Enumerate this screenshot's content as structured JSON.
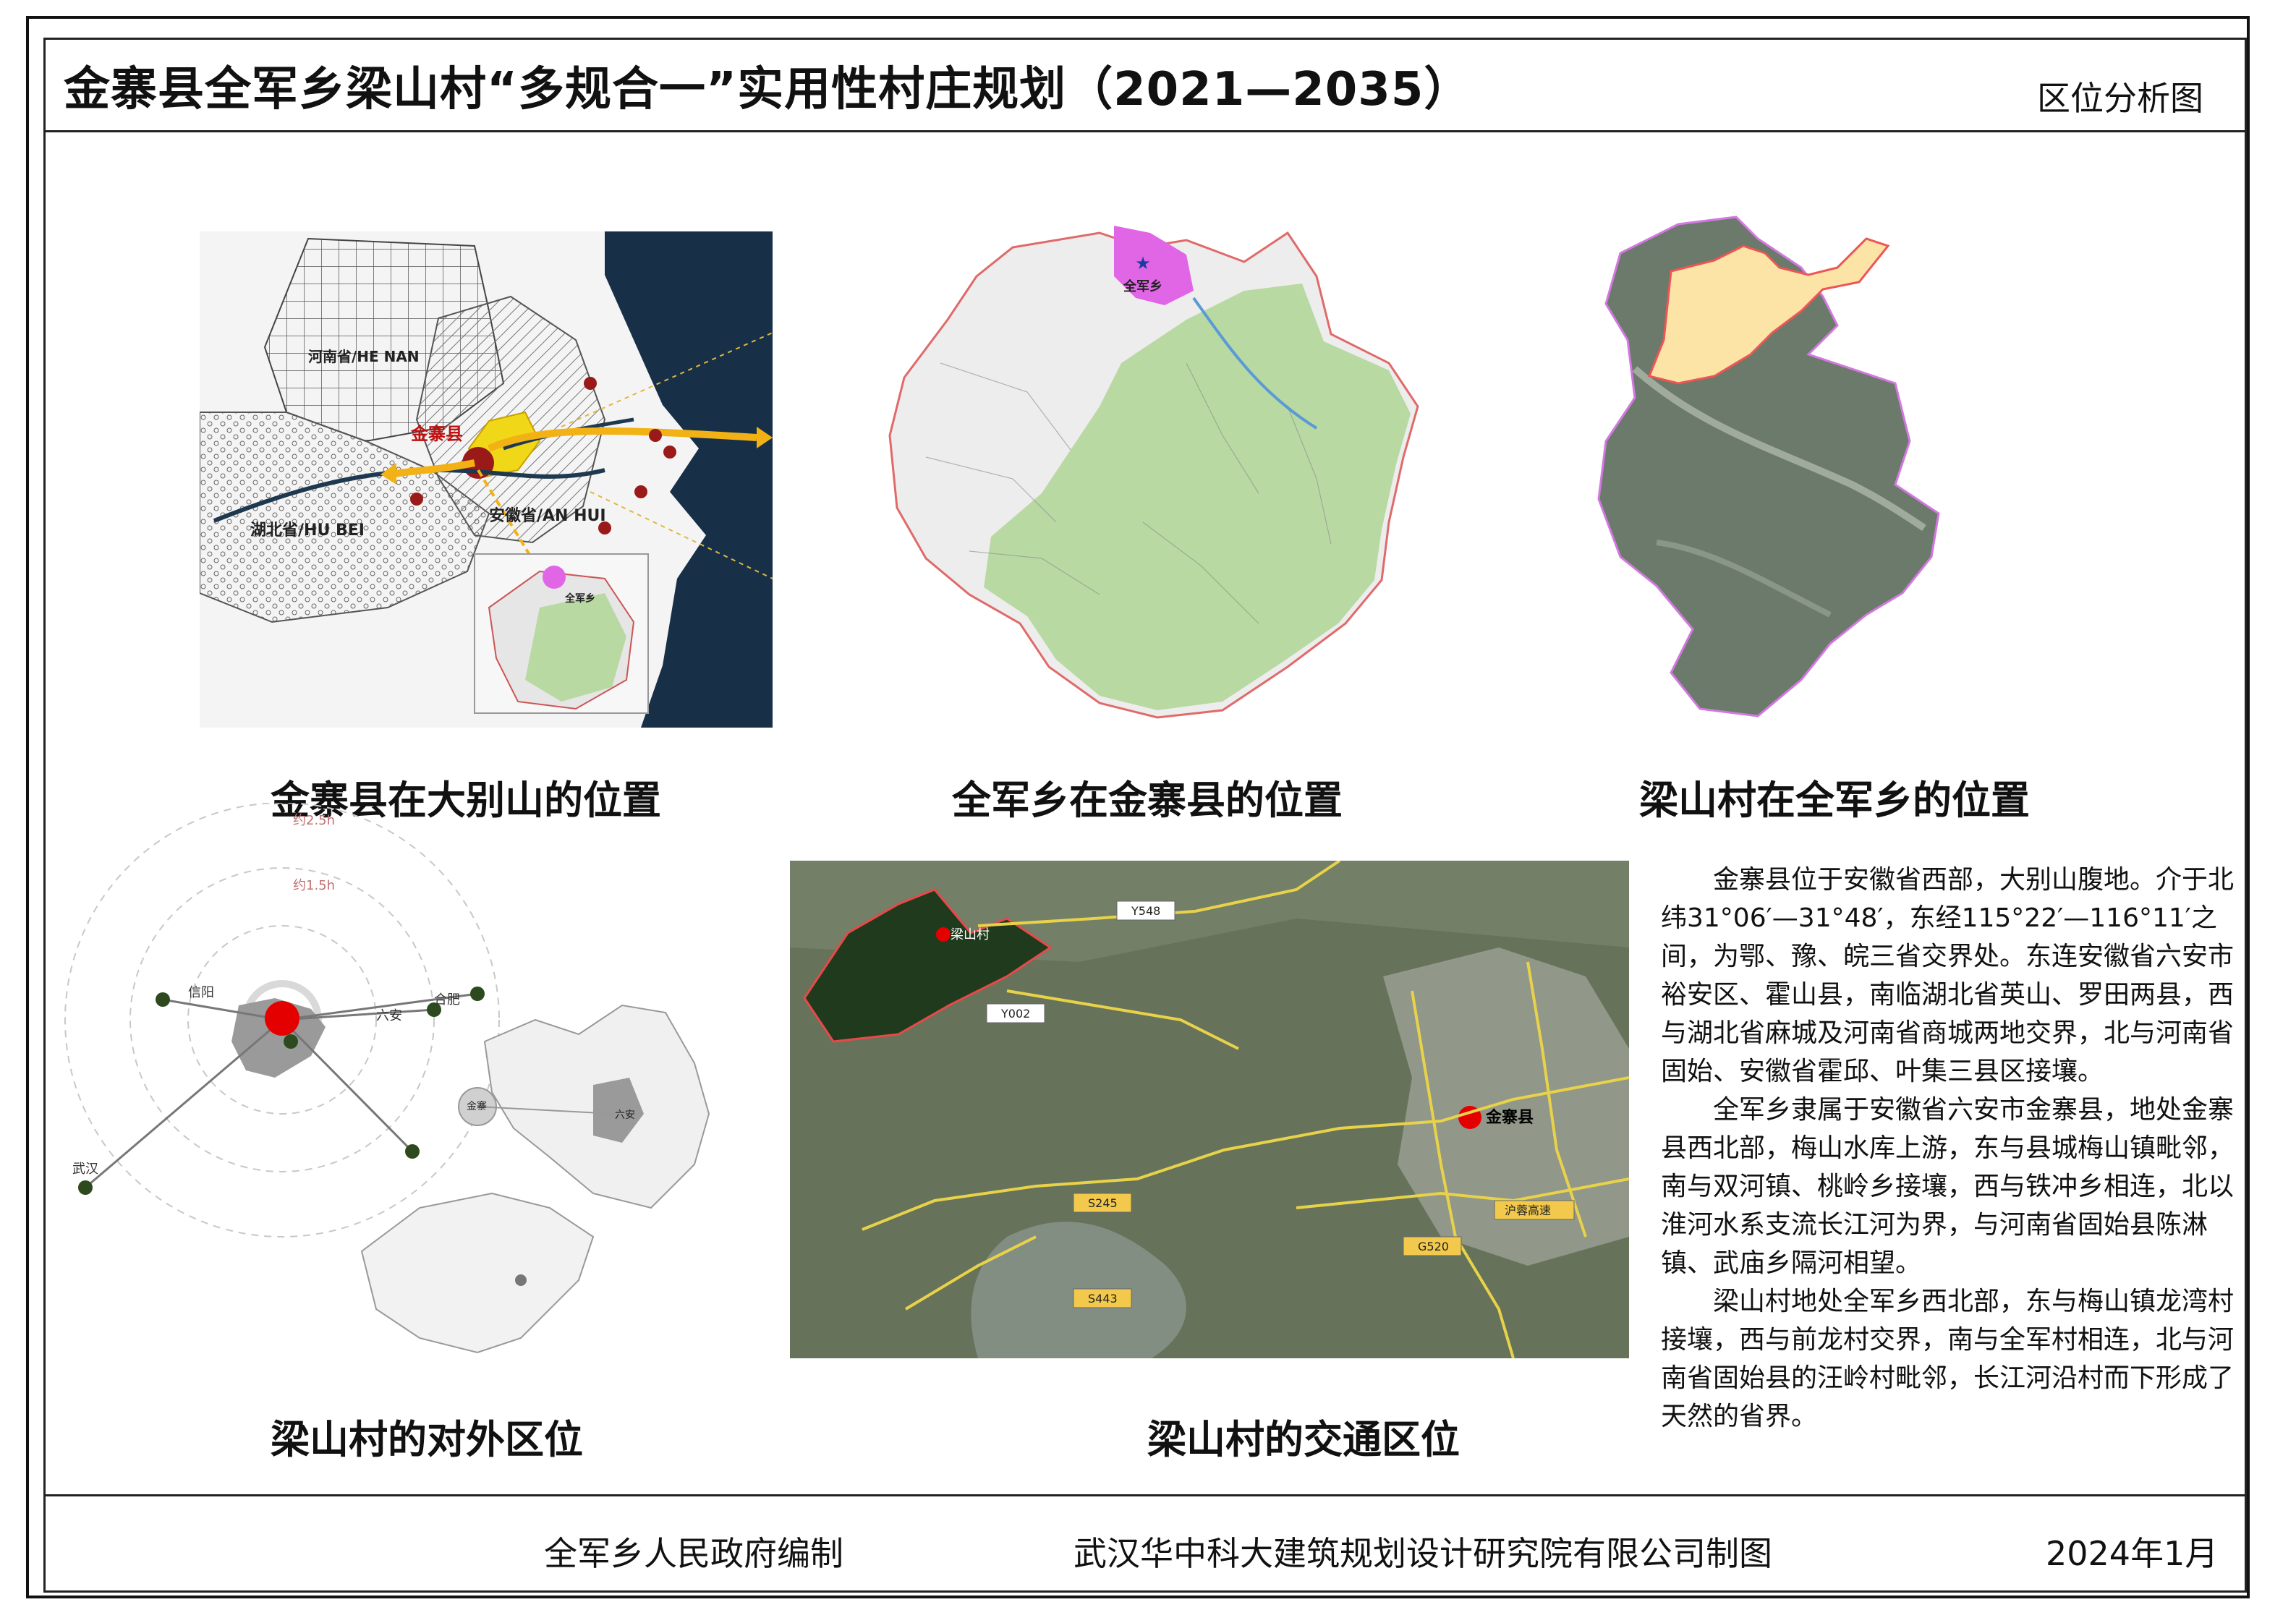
{
  "header": {
    "title": "金寨县全军乡梁山村“多规合一”实用性村庄规划（2021—2035）",
    "sheet_name": "区位分析图"
  },
  "maps": [
    {
      "caption": "金寨县在大别山的位置",
      "labels": [
        "河南省/HE NAN",
        "湖北省/HU BEI",
        "安徽省/AN HUI",
        "金寨县",
        "全军乡"
      ]
    },
    {
      "caption": "全军乡在金寨县的位置",
      "labels": [
        "全军乡"
      ]
    },
    {
      "caption": "梁山村在全军乡的位置",
      "labels": []
    },
    {
      "caption": "梁山村的对外区位",
      "labels": [
        "约2.5h",
        "约1.5h",
        "信阳",
        "六安",
        "合肥",
        "武汉",
        "金寨",
        "六安"
      ]
    },
    {
      "caption": "梁山村的交通区位",
      "labels": [
        "梁山村",
        "Y548",
        "Y002",
        "金寨县",
        "S245",
        "S443",
        "G520",
        "沪蓉高速"
      ]
    }
  ],
  "description": [
    "金寨县位于安徽省西部，大别山腹地。介于北纬31°06′—31°48′，东经115°22′—116°11′之间，为鄂、豫、皖三省交界处。东连安徽省六安市裕安区、霍山县，南临湖北省英山、罗田两县，西与湖北省麻城及河南省商城两地交界，北与河南省固始、安徽省霍邱、叶集三县区接壤。",
    "全军乡隶属于安徽省六安市金寨县，地处金寨县西北部，梅山水库上游，东与县城梅山镇毗邻，南与双河镇、桃岭乡接壤，西与铁冲乡相连，北以淮河水系支流长江河为界，与河南省固始县陈淋镇、武庙乡隔河相望。",
    "梁山村地处全军乡西北部，东与梅山镇龙湾村接壤，西与前龙村交界，南与全军村相连，北与河南省固始县的汪岭村毗邻，长江河沿村而下形成了天然的省界。"
  ],
  "footer": {
    "compiler": "全军乡人民政府编制",
    "designer": "武汉华中科大建筑规划设计研究院有限公司制图",
    "date": "2024年1月"
  },
  "colors": {
    "ocean": "#173047",
    "highlight_magenta": "#e066e6",
    "county_yellow": "#f0d818",
    "arrow_orange": "#f2b215",
    "marker_red": "#e50000",
    "village_fill": "#fbe4a6",
    "forest_green": "#b9d9a3"
  }
}
